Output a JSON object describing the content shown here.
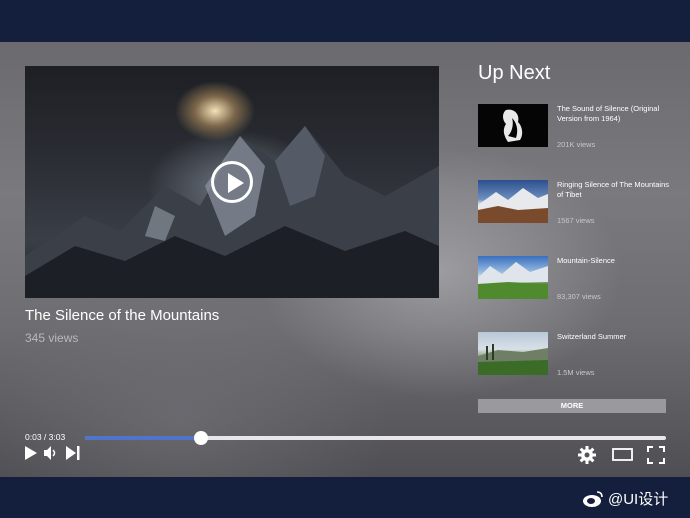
{
  "player": {
    "title": "The Silence of the Mountains",
    "views": "345 views",
    "time": "0:03 / 3:03",
    "progress": 0.2
  },
  "up_next": {
    "heading": "Up Next",
    "items": [
      {
        "title": "The Sound of Silence (Original Version from 1964)",
        "views": "201K views"
      },
      {
        "title": "Ringing Silence of The Mountains of Tibet",
        "views": "1567 views"
      },
      {
        "title": "Mountain-Silence",
        "views": "83,307 views"
      },
      {
        "title": "Switzerland Summer",
        "views": "1.5M views"
      }
    ],
    "more_label": "MORE"
  },
  "controls": {
    "icons": [
      "play-icon",
      "volume-icon",
      "skip-next-icon",
      "settings-gear-icon",
      "theater-mode-icon",
      "fullscreen-icon"
    ]
  },
  "watermark": "@UI设计"
}
